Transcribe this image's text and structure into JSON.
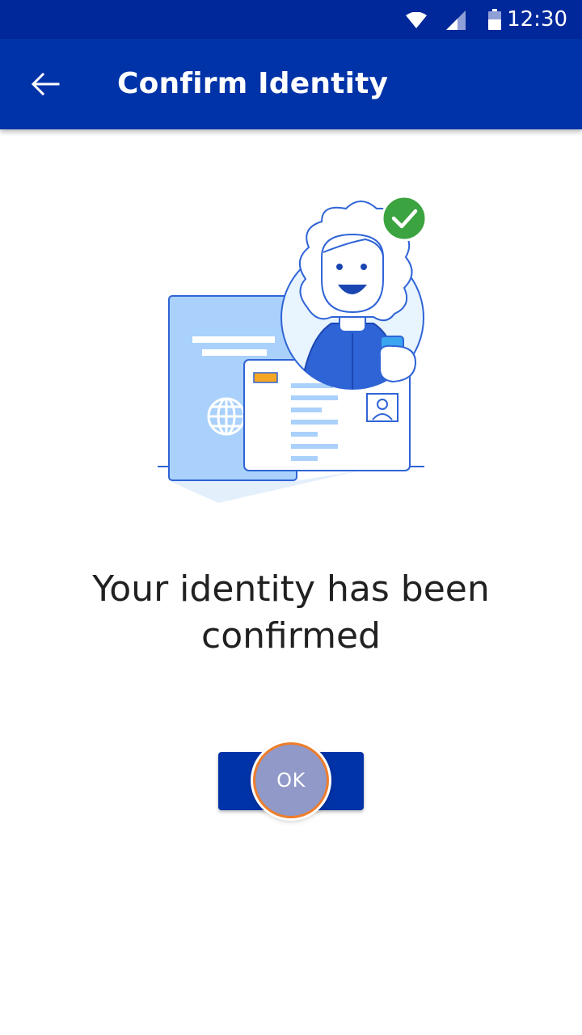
{
  "status_bar": {
    "time": "12:30",
    "icons": [
      "wifi-icon",
      "signal-icon",
      "battery-icon"
    ]
  },
  "app_bar": {
    "title": "Confirm Identity",
    "back_icon": "arrow-left-icon"
  },
  "illustration": {
    "name": "identity-confirmed-illustration",
    "badge_icon": "checkmark-icon"
  },
  "message": "Your identity has been confirmed",
  "ok_button": {
    "label": "OK"
  },
  "colors": {
    "status_bar": "#00289a",
    "app_bar": "#0033a8",
    "success": "#3ba33f",
    "text": "#212121"
  }
}
